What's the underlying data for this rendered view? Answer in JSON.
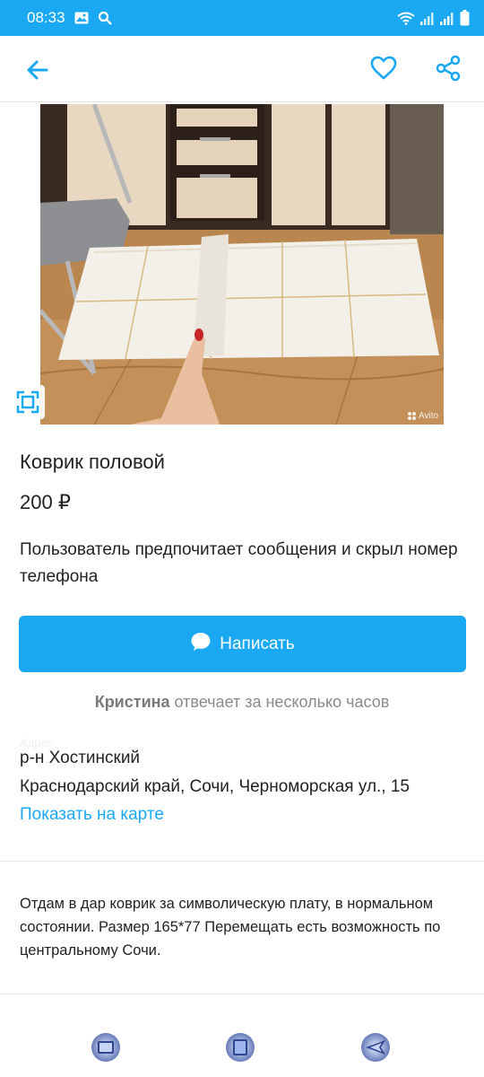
{
  "status_bar": {
    "time": "08:33",
    "icons": [
      "image-icon",
      "search-icon",
      "wifi-icon",
      "signal-icon",
      "signal-icon",
      "battery-icon"
    ]
  },
  "app_bar": {
    "icons": [
      "back-arrow-icon",
      "heart-icon",
      "share-icon"
    ]
  },
  "listing": {
    "photo_watermark": "Avito",
    "title": "Коврик половой",
    "price": "200 ₽",
    "contact_preference": "Пользователь предпочитает сообщения и скрыл номер телефона",
    "write_button_label": "Написать",
    "seller": {
      "name": "Кристина",
      "response_time": "отвечает за несколько часов"
    },
    "location": {
      "label": "Адрес",
      "district": "р-н Хостинский",
      "address": "Краснодарский край, Сочи, Черноморская ул., 15",
      "map_link": "Показать на карте"
    },
    "description": "Отдам в дар коврик за символическую плату, в нормальном состоянии. Размер 165*77 Перемещать есть возможность по центральному Сочи."
  },
  "colors": {
    "accent": "#1aa8f2",
    "muted_text": "#8a8a8a",
    "divider": "#e6e6e6"
  },
  "bottom_nav": {
    "icons": [
      "recent-apps-icon",
      "home-icon",
      "back-icon"
    ]
  }
}
